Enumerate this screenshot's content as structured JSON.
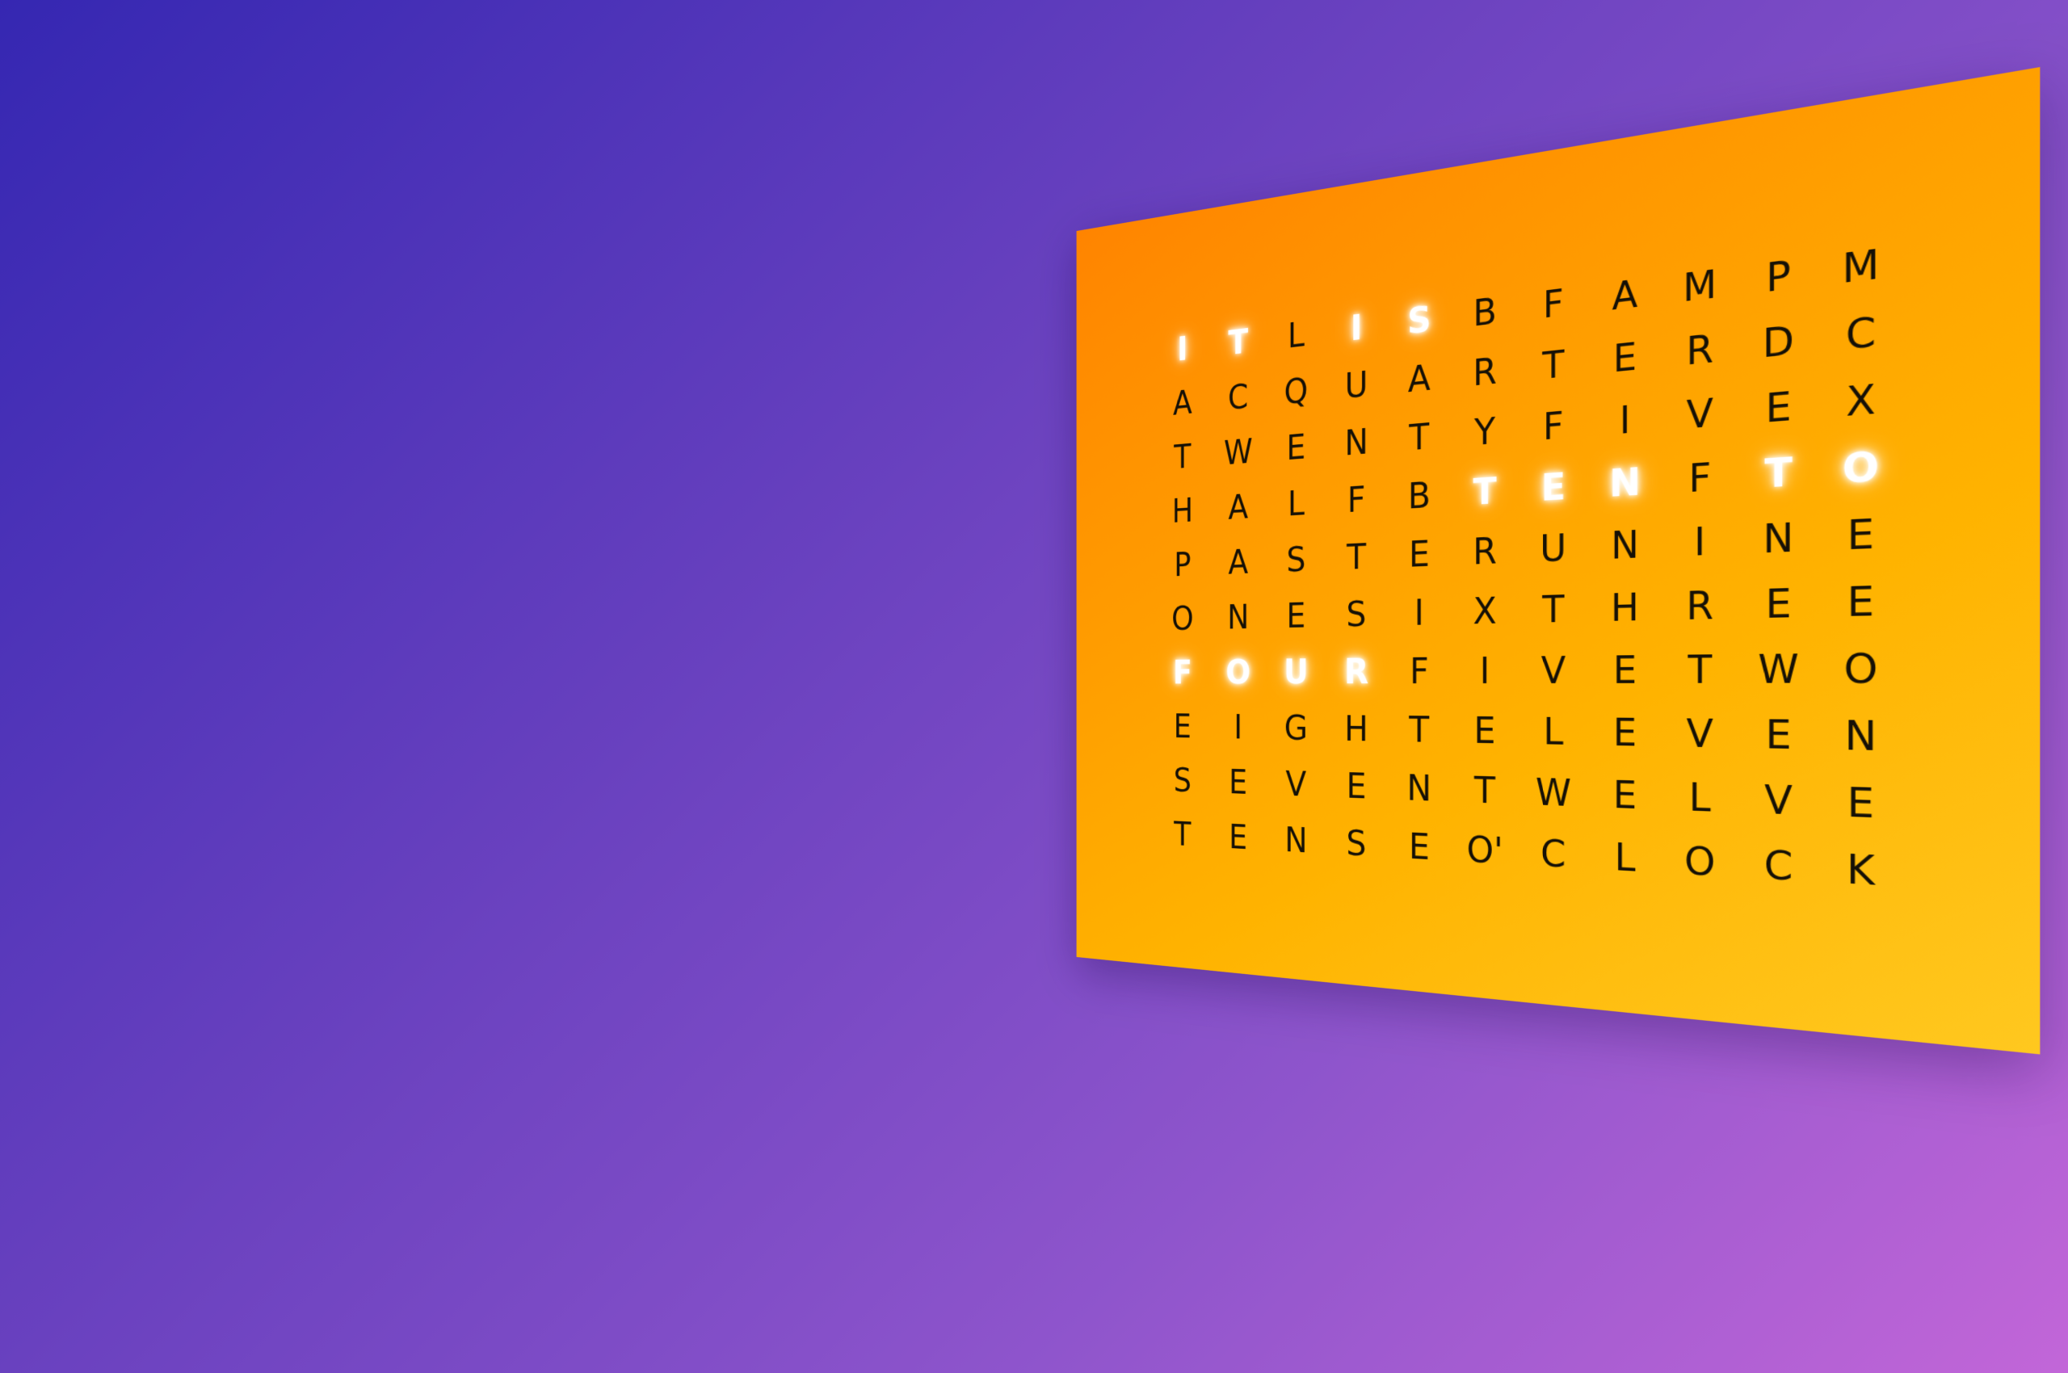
{
  "clock": {
    "rows": [
      "ITLISBFAMPM",
      "ACQUARTERDC",
      "TWENTYFIVEX",
      "HALFBTENFTO",
      "PASTERUNINE",
      "ONESIXTHREE",
      "FOURFIVETWO",
      "EIGHTELEVEN",
      "SEVENTWELVE",
      "TENSEO'CLOCK"
    ],
    "lit_cells": [
      [
        0,
        0
      ],
      [
        0,
        1
      ],
      [
        0,
        3
      ],
      [
        0,
        4
      ],
      [
        3,
        5
      ],
      [
        3,
        6
      ],
      [
        3,
        7
      ],
      [
        3,
        9
      ],
      [
        3,
        10
      ],
      [
        6,
        0
      ],
      [
        6,
        1
      ],
      [
        6,
        2
      ],
      [
        6,
        3
      ]
    ]
  }
}
